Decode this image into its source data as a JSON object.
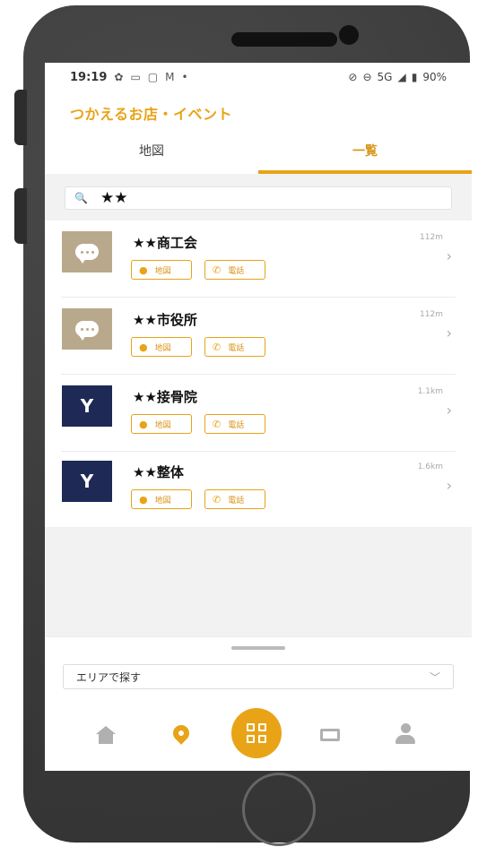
{
  "status": {
    "time": "19:19",
    "left_icons": [
      "gear-icon",
      "square-icon",
      "message-icon",
      "mail-icon",
      "dot-icon"
    ],
    "right_text": "5G",
    "battery": "90%"
  },
  "header": {
    "title": "つかえるお店・イベント"
  },
  "tabs": [
    {
      "label": "地図",
      "active": false
    },
    {
      "label": "一覧",
      "active": true
    }
  ],
  "search": {
    "value": "★★"
  },
  "list": [
    {
      "name": "★★商工会",
      "distance": "112m",
      "thumb": "chat-icon",
      "map_label": "地図",
      "tel_label": "電話"
    },
    {
      "name": "★★市役所",
      "distance": "112m",
      "thumb": "chat-icon",
      "map_label": "地図",
      "tel_label": "電話"
    },
    {
      "name": "★★接骨院",
      "distance": "1.1km",
      "thumb": "cocktail-icon",
      "map_label": "地図",
      "tel_label": "電話"
    },
    {
      "name": "★★整体",
      "distance": "1.6km",
      "thumb": "cocktail-icon",
      "map_label": "地図",
      "tel_label": "電話"
    }
  ],
  "sheet": {
    "area_label": "エリアで探す"
  },
  "nav": [
    "home-icon",
    "map-pin-icon",
    "qr-code-icon",
    "ticket-icon",
    "user-icon"
  ],
  "colors": {
    "accent": "#e8a317",
    "chat_thumb": "#b9a98c",
    "bar_thumb": "#1e2a55"
  }
}
